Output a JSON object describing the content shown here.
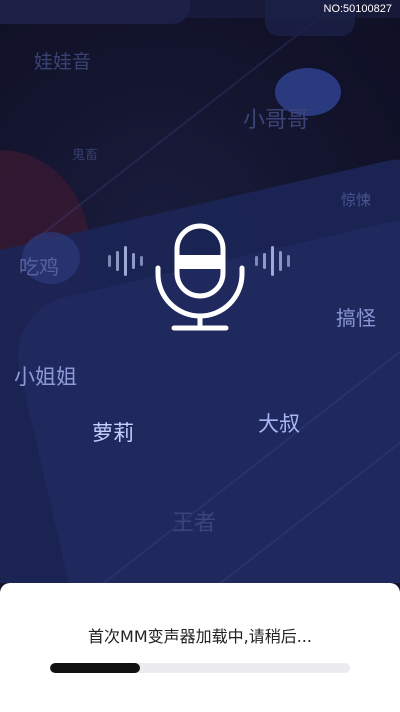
{
  "build_no": "NO:50100827",
  "voice_effects": [
    {
      "id": "wawayin",
      "label": "娃娃音",
      "color": "#3a4274"
    },
    {
      "id": "xiaogege",
      "label": "小哥哥",
      "color": "#3c4578"
    },
    {
      "id": "guichu",
      "label": "鬼畜",
      "color": "#353d6a"
    },
    {
      "id": "jingsong",
      "label": "惊悚",
      "color": "#4a5590"
    },
    {
      "id": "chiji",
      "label": "吃鸡",
      "color": "#56619d"
    },
    {
      "id": "gaoguai",
      "label": "搞怪",
      "color": "#8a96d4"
    },
    {
      "id": "xiaojiejie",
      "label": "小姐姐",
      "color": "#8e9ad8"
    },
    {
      "id": "luoli",
      "label": "萝莉",
      "color": "#c7d0ff"
    },
    {
      "id": "dashu",
      "label": "大叔",
      "color": "#a8b6f4"
    },
    {
      "id": "wangzhe",
      "label": "王者",
      "color": "#3b4579"
    }
  ],
  "mic": {
    "icon": "microphone-icon",
    "color": "#ffffff"
  },
  "loading": {
    "message": "首次MM变声器加载中,请稍后...",
    "progress": 0.3
  }
}
